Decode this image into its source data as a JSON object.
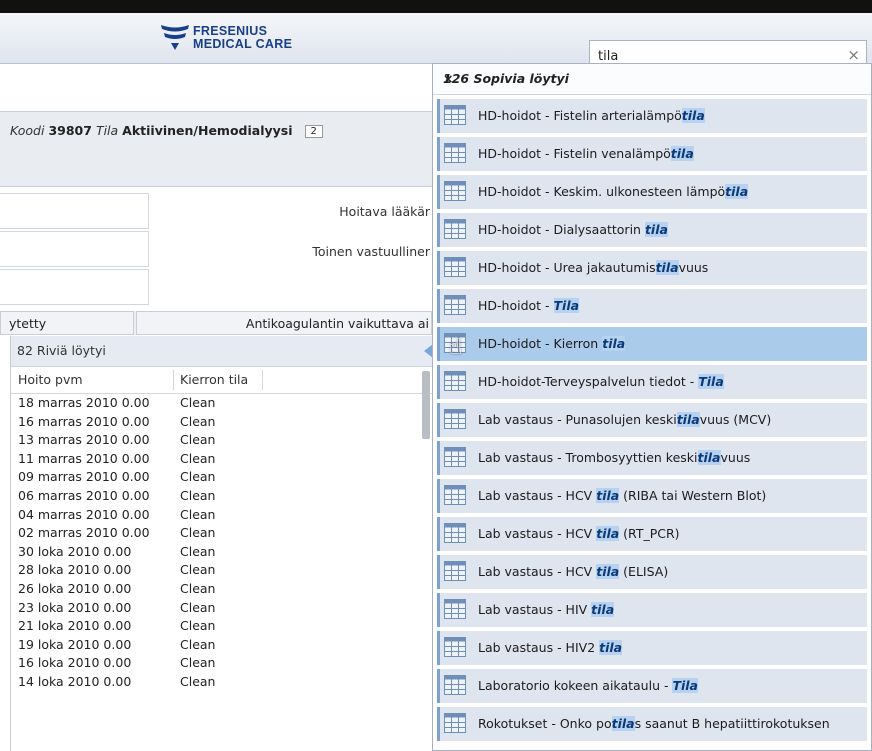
{
  "header": {
    "logo_line1": "FRESENIUS",
    "logo_line2": "MEDICAL CARE",
    "search_value": "tila",
    "clear_icon": "×"
  },
  "patient": {
    "code_label": "Koodi",
    "code_value": "39807",
    "status_label": "Tila",
    "status_value": "Aktiivinen/Hemodialyysi",
    "badge": "2"
  },
  "form": {
    "label_doctor": "Hoitava lääkär",
    "label_second": "Toinen vastuulliner"
  },
  "tabs": [
    {
      "label": "ytetty"
    },
    {
      "label": "Antikoagulantin vaikuttava ai"
    }
  ],
  "grid": {
    "count_text": "82 Riviä löytyi",
    "col1": "Hoito pvm",
    "col2": "Kierron tila",
    "rows": [
      [
        "18 marras 2010 0.00",
        "Clean"
      ],
      [
        "16 marras 2010 0.00",
        "Clean"
      ],
      [
        "13 marras 2010 0.00",
        "Clean"
      ],
      [
        "11 marras 2010 0.00",
        "Clean"
      ],
      [
        "09 marras 2010 0.00",
        "Clean"
      ],
      [
        "06 marras 2010 0.00",
        "Clean"
      ],
      [
        "04 marras 2010 0.00",
        "Clean"
      ],
      [
        "02 marras 2010 0.00",
        "Clean"
      ],
      [
        "30 loka 2010 0.00",
        "Clean"
      ],
      [
        "28 loka 2010 0.00",
        "Clean"
      ],
      [
        "26 loka 2010 0.00",
        "Clean"
      ],
      [
        "23 loka 2010 0.00",
        "Clean"
      ],
      [
        "21 loka 2010 0.00",
        "Clean"
      ],
      [
        "19 loka 2010 0.00",
        "Clean"
      ],
      [
        "16 loka 2010 0.00",
        "Clean"
      ],
      [
        "14 loka 2010 0.00",
        "Clean"
      ]
    ]
  },
  "dropdown": {
    "title": "126 Sopivia löytyi",
    "close_icon": "×",
    "items": [
      {
        "pre": "HD-hoidot - Fistelin arterialämpö",
        "hl": "tila",
        "post": ""
      },
      {
        "pre": "HD-hoidot - Fistelin venalämpö",
        "hl": "tila",
        "post": ""
      },
      {
        "pre": "HD-hoidot - Keskim. ulkonesteen lämpö",
        "hl": "tila",
        "post": ""
      },
      {
        "pre": "HD-hoidot - Dialysaattorin ",
        "hl": "tila",
        "post": ""
      },
      {
        "pre": "HD-hoidot - Urea jakautumis",
        "hl": "tila",
        "post": "vuus"
      },
      {
        "pre": "HD-hoidot - ",
        "hl": "Tila",
        "post": ""
      },
      {
        "pre": "HD-hoidot - Kierron ",
        "hl": "tila",
        "post": "",
        "hover": true
      },
      {
        "pre": "HD-hoidot-Terveyspalvelun tiedot - ",
        "hl": "Tila",
        "post": ""
      },
      {
        "pre": "Lab vastaus - Punasolujen keski",
        "hl": "tila",
        "post": "vuus (MCV)"
      },
      {
        "pre": "Lab vastaus - Trombosyyttien keski",
        "hl": "tila",
        "post": "vuus"
      },
      {
        "pre": "Lab vastaus - HCV ",
        "hl": "tila",
        "post": " (RIBA tai Western Blot)"
      },
      {
        "pre": "Lab vastaus - HCV ",
        "hl": "tila",
        "post": " (RT_PCR)"
      },
      {
        "pre": "Lab vastaus - HCV ",
        "hl": "tila",
        "post": " (ELISA)"
      },
      {
        "pre": "Lab vastaus - HIV ",
        "hl": "tila",
        "post": ""
      },
      {
        "pre": "Lab vastaus - HIV2 ",
        "hl": "tila",
        "post": ""
      },
      {
        "pre": "Laboratorio kokeen aikataulu - ",
        "hl": "Tila",
        "post": ""
      },
      {
        "pre": "Rokotukset - Onko po",
        "hl": "tila",
        "post": "s saanut B hepatiittirokotuksen"
      }
    ]
  },
  "colors": {
    "accent": "#1a3f8a",
    "item_bg": "#dfe5ef",
    "item_hover": "#aacbe9"
  }
}
